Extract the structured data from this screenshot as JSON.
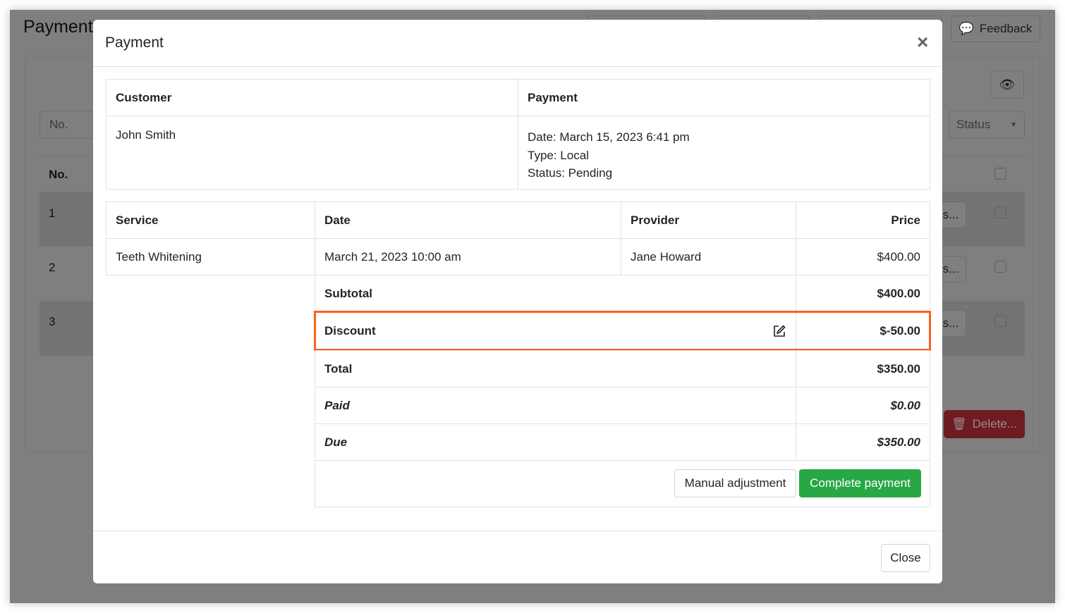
{
  "background": {
    "page_title": "Payment",
    "feedback_label": "Feedback",
    "filter_placeholder": "No.",
    "status_select": "Status",
    "col_no": "No.",
    "rows": [
      "1",
      "2",
      "3"
    ],
    "row_btn": "s...",
    "delete_label": "Delete..."
  },
  "modal": {
    "title": "Payment",
    "close_x": "×",
    "customer": {
      "header": "Customer",
      "name": "John Smith"
    },
    "payment": {
      "header": "Payment",
      "date": "Date: March 15, 2023 6:41 pm",
      "type": "Type: Local",
      "status": "Status: Pending"
    },
    "services": {
      "headers": [
        "Service",
        "Date",
        "Provider",
        "Price"
      ],
      "rows": [
        {
          "service": "Teeth Whitening",
          "date": "March 21, 2023 10:00 am",
          "provider": "Jane Howard",
          "price": "$400.00"
        }
      ]
    },
    "summary": {
      "subtotal_label": "Subtotal",
      "subtotal": "$400.00",
      "discount_label": "Discount",
      "discount": "$-50.00",
      "total_label": "Total",
      "total": "$350.00",
      "paid_label": "Paid",
      "paid": "$0.00",
      "due_label": "Due",
      "due": "$350.00"
    },
    "manual_adjustment": "Manual adjustment",
    "complete_payment": "Complete payment",
    "close": "Close"
  },
  "colors": {
    "highlight": "#fd5f1c",
    "success": "#28a745",
    "danger": "#dc3545"
  }
}
